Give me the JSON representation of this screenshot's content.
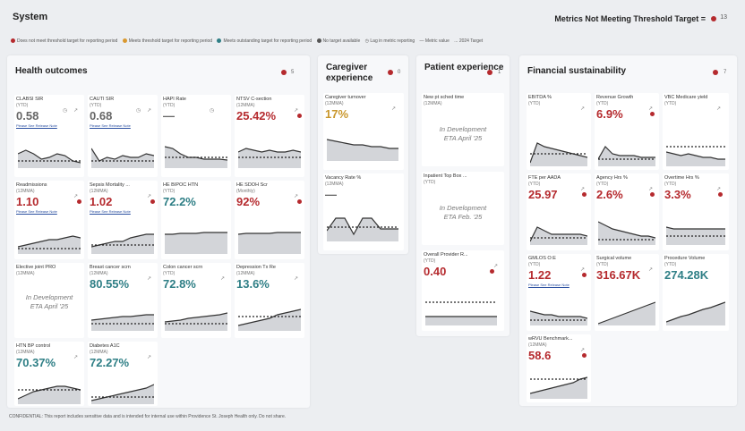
{
  "header": {
    "title": "System",
    "metrics_label": "Metrics Not Meeting Threshold Target =",
    "metrics_count": "13"
  },
  "legend": [
    {
      "color": "#b52a2e",
      "label": "Does not meet threshold target for reporting period"
    },
    {
      "color": "#d9982f",
      "label": "Meets threshold target for reporting period"
    },
    {
      "color": "#2f7f86",
      "label": "Meets outstanding target for reporting period"
    },
    {
      "color": "#555555",
      "label": "No target available"
    },
    {
      "color": "",
      "label": "Lag in metric reporting"
    },
    {
      "color": "",
      "label": "— Metric value"
    },
    {
      "color": "",
      "label": "... 2024 Target"
    }
  ],
  "panels": {
    "health": {
      "title": "Health outcomes",
      "count": "5"
    },
    "caregiver": {
      "title": "Caregiver experience",
      "count": "0"
    },
    "patient": {
      "title": "Patient experience",
      "count": "1"
    },
    "financial": {
      "title": "Financial sustainability",
      "count": "7"
    }
  },
  "tiles": {
    "clabsi": {
      "name": "CLABSI SIR",
      "period": "(YTD)",
      "value": "0.58",
      "note": "Please See Release Note"
    },
    "cauti": {
      "name": "CAUTI SIR",
      "period": "(YTD)",
      "value": "0.68",
      "note": "Please See Release Note"
    },
    "hapi": {
      "name": "HAPI Rate",
      "period": "(YTD)",
      "value": "—"
    },
    "ntsv": {
      "name": "NTSV C-section",
      "period": "(12MMA)",
      "value": "25.42%"
    },
    "readmissions": {
      "name": "Readmissions",
      "period": "(12MMA)",
      "value": "1.10",
      "note": "Please See Release Note"
    },
    "sepsis": {
      "name": "Sepsis Mortality ...",
      "period": "(12MMA)",
      "value": "1.02",
      "note": "Please See Release Note"
    },
    "bipoc": {
      "name": "HE BIPOC HTN",
      "period": "(YTD)",
      "value": "72.2%"
    },
    "sdoh": {
      "name": "HE SDOH Scr",
      "period": "(Monthly)",
      "value": "92%"
    },
    "elective": {
      "name": "Elective joint PRO",
      "period": "(12MMA)",
      "dev1": "In Development",
      "dev2": "ETA April '25"
    },
    "breast": {
      "name": "Breast cancer scrn",
      "period": "(12MMA)",
      "value": "80.55%"
    },
    "colon": {
      "name": "Colon cancer scrn",
      "period": "(YTD)",
      "value": "72.8%"
    },
    "depression": {
      "name": "Depression Tx Re",
      "period": "(12MMA)",
      "value": "13.6%"
    },
    "htnbp": {
      "name": "HTN BP control",
      "period": "(12MMA)",
      "value": "70.37%"
    },
    "diabetes": {
      "name": "Diabetes A1C",
      "period": "(12MMA)",
      "value": "72.27%"
    },
    "turnover": {
      "name": "Caregiver turnover",
      "period": "(12MMA)",
      "value": "17%"
    },
    "vacancy": {
      "name": "Vacancy Rate %",
      "period": "(12MMA)",
      "value": "—"
    },
    "newpt": {
      "name": "New pt sched time",
      "period": "(12MMA)",
      "dev1": "In Development",
      "dev2": "ETA April '25"
    },
    "inpatient": {
      "name": "Inpatient Top Box ...",
      "period": "(YTD)",
      "dev1": "In Development",
      "dev2": "ETA Feb. '25"
    },
    "overall": {
      "name": "Overall Provider R...",
      "period": "(YTD)",
      "value": "0.40"
    },
    "ebitda": {
      "name": "EBITDA %",
      "period": "(YTD)",
      "value": ""
    },
    "revenue": {
      "name": "Revenue Growth",
      "period": "(YTD)",
      "value": "6.9%"
    },
    "vbc": {
      "name": "VBC Medicare yield",
      "period": "(YTD)",
      "value": ""
    },
    "fte": {
      "name": "FTE per AADA",
      "period": "(YTD)",
      "value": "25.97"
    },
    "agency": {
      "name": "Agency Hrs %",
      "period": "(YTD)",
      "value": "2.6%"
    },
    "overtime": {
      "name": "Overtime Hrs %",
      "period": "(YTD)",
      "value": "3.3%"
    },
    "gmlos": {
      "name": "GMLOS O:E",
      "period": "(YTD)",
      "value": "1.22",
      "note": "Please See Release Note"
    },
    "surgical": {
      "name": "Surgical volume",
      "period": "(YTD)",
      "value": "316.67K"
    },
    "procedure": {
      "name": "Procedure Volume",
      "period": "(YTD)",
      "value": "274.28K"
    },
    "wrvu": {
      "name": "wRVU Benchmark...",
      "period": "(12MMA)",
      "value": "58.6"
    }
  },
  "footer": "CONFIDENTIAL: This report includes sensitive data and is intended for internal use within Providence St. Joseph Health only. Do not share."
}
